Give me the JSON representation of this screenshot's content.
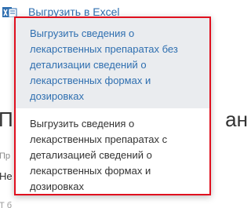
{
  "colors": {
    "highlight_border": "#e0101f",
    "link_blue": "#2f6fb0",
    "active_bg": "#eaecef"
  },
  "background": {
    "toolbar_text": "Выгрузить в Excel",
    "heading_left": "П",
    "heading_right": "ан",
    "label": "Пр",
    "text": "Не",
    "bottom": "Т б"
  },
  "menu": {
    "options": [
      {
        "label": "Выгрузить сведения о лекарственных препаратах без детализации сведений о лекарственных формах и дозировках",
        "state": "hovered"
      },
      {
        "label": "Выгрузить сведения о лекарственных препаратах с детализацией сведений о лекарственных формах и дозировках",
        "state": "normal"
      }
    ]
  }
}
